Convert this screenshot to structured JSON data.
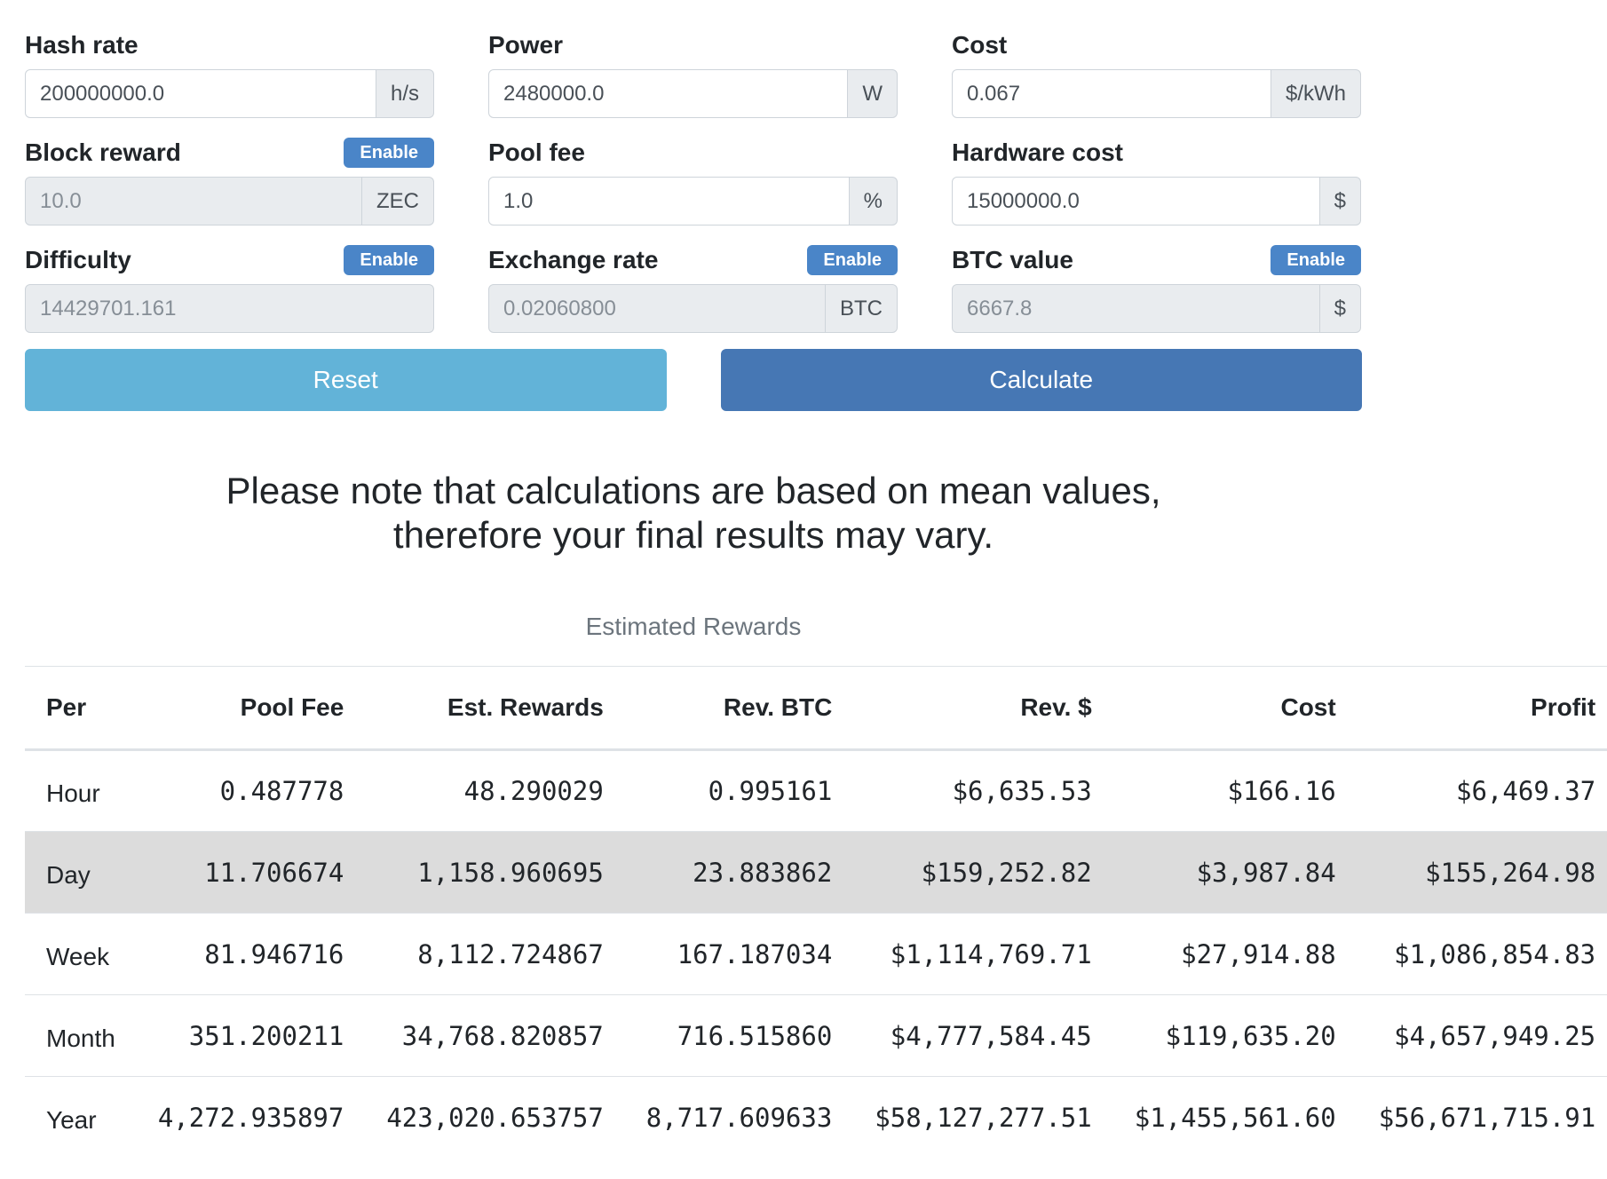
{
  "form": {
    "hash_rate": {
      "label": "Hash rate",
      "value": "200000000.0",
      "unit": "h/s"
    },
    "power": {
      "label": "Power",
      "value": "2480000.0",
      "unit": "W"
    },
    "cost": {
      "label": "Cost",
      "value": "0.067",
      "unit": "$/kWh"
    },
    "block_reward": {
      "label": "Block reward",
      "enable": "Enable",
      "value": "10.0",
      "unit": "ZEC"
    },
    "pool_fee": {
      "label": "Pool fee",
      "value": "1.0",
      "unit": "%"
    },
    "hardware_cost": {
      "label": "Hardware cost",
      "value": "15000000.0",
      "unit": "$"
    },
    "difficulty": {
      "label": "Difficulty",
      "enable": "Enable",
      "value": "14429701.161"
    },
    "exchange_rate": {
      "label": "Exchange rate",
      "enable": "Enable",
      "value": "0.02060800",
      "unit": "BTC"
    },
    "btc_value": {
      "label": "BTC value",
      "enable": "Enable",
      "value": "6667.8",
      "unit": "$"
    }
  },
  "buttons": {
    "reset": "Reset",
    "calculate": "Calculate"
  },
  "note": {
    "line1": "Please note that calculations are based on mean values,",
    "line2": "therefore your final results may vary."
  },
  "table": {
    "caption": "Estimated Rewards",
    "headers": [
      "Per",
      "Pool Fee",
      "Est. Rewards",
      "Rev. BTC",
      "Rev. $",
      "Cost",
      "Profit"
    ],
    "rows": [
      [
        "Hour",
        "0.487778",
        "48.290029",
        "0.995161",
        "$6,635.53",
        "$166.16",
        "$6,469.37"
      ],
      [
        "Day",
        "11.706674",
        "1,158.960695",
        "23.883862",
        "$159,252.82",
        "$3,987.84",
        "$155,264.98"
      ],
      [
        "Week",
        "81.946716",
        "8,112.724867",
        "167.187034",
        "$1,114,769.71",
        "$27,914.88",
        "$1,086,854.83"
      ],
      [
        "Month",
        "351.200211",
        "34,768.820857",
        "716.515860",
        "$4,777,584.45",
        "$119,635.20",
        "$4,657,949.25"
      ],
      [
        "Year",
        "4,272.935897",
        "423,020.653757",
        "8,717.609633",
        "$58,127,277.51",
        "$1,455,561.60",
        "$56,671,715.91"
      ]
    ]
  },
  "colors": {
    "enable_button": "#4a85c8",
    "reset_button": "#62b3d8",
    "calculate_button": "#4677b4",
    "highlight_row": "#dcdcdc"
  }
}
